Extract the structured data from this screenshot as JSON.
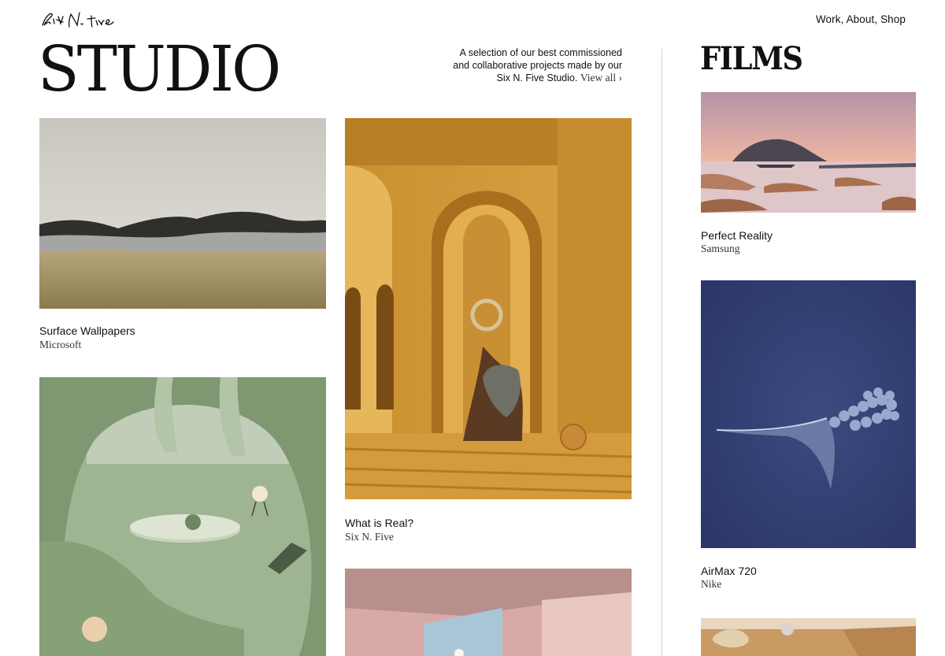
{
  "header": {
    "logo_text": "Six N. Five",
    "nav": [
      "Work,",
      "About,",
      "Shop"
    ]
  },
  "studio": {
    "title": "STUDIO",
    "intro_line1": "A selection of our best commissioned",
    "intro_line2": "and collaborative projects made by our",
    "intro_line3": "Six N. Five Studio.",
    "view_all": "View all ›"
  },
  "films": {
    "title": "FILMS"
  },
  "projects": [
    {
      "title": "Surface Wallpapers",
      "client": "Microsoft"
    },
    {
      "title": "What is Real?",
      "client": "Six N. Five"
    }
  ],
  "film_items": [
    {
      "title": "Perfect Reality",
      "client": "Samsung"
    },
    {
      "title": "AirMax 720",
      "client": "Nike"
    }
  ]
}
